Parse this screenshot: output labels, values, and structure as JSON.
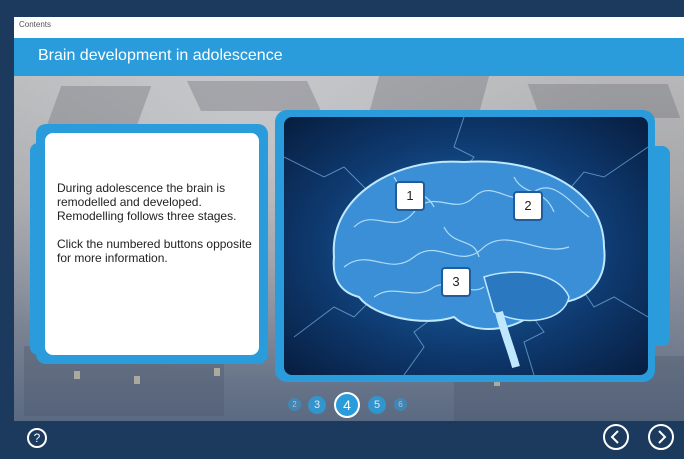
{
  "header": {
    "contents_label": "Contents"
  },
  "slide": {
    "title": "Brain development in adolescence"
  },
  "text_panel": {
    "paragraph1": "During adolescence the brain is remodelled and developed. Remodelling follows three stages.",
    "paragraph2": "Click the numbered buttons opposite for more information."
  },
  "hotspots": [
    {
      "label": "1"
    },
    {
      "label": "2"
    },
    {
      "label": "3"
    }
  ],
  "pagination": {
    "pages": [
      "2",
      "3",
      "4",
      "5",
      "6"
    ],
    "current": "4"
  },
  "footer": {
    "help_icon": "question-mark-icon",
    "prev_icon": "chevron-left-icon",
    "next_icon": "chevron-right-icon"
  },
  "colors": {
    "accent": "#2a9cdb",
    "dark": "#1c3a5e",
    "brain": "#1f6fb0"
  }
}
